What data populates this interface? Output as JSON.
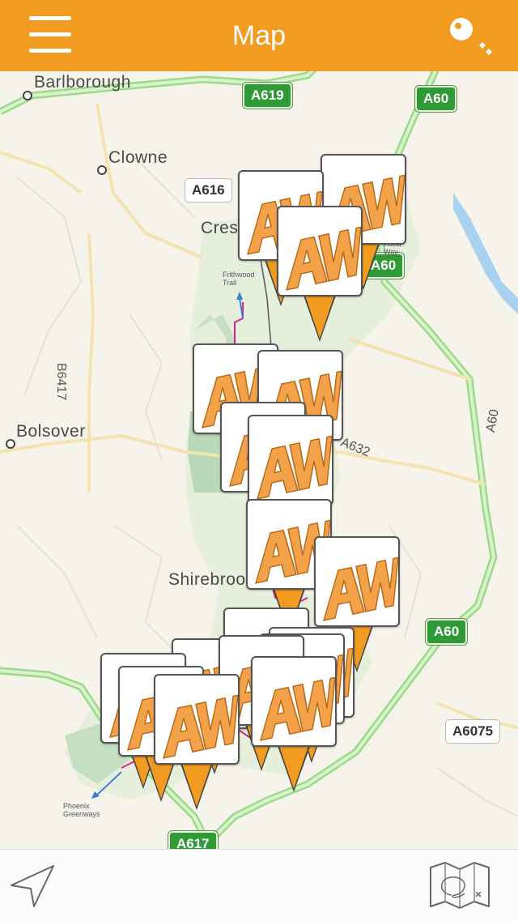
{
  "header": {
    "title": "Map",
    "menu_icon": "hamburger-menu-icon",
    "key_icon": "key-icon",
    "background": "#f19c20"
  },
  "map": {
    "places": {
      "barlborough": "Barlborough",
      "clowne": "Clowne",
      "creswell": "Cres",
      "bolsover": "Bolsover",
      "shirebrook": "Shirebrook"
    },
    "roads": {
      "a619": "A619",
      "a60_top": "A60",
      "a616": "A616",
      "a60_mid": "A60",
      "b6417": "B6417",
      "a632": "A632",
      "a60_right": "A60",
      "a60_lower": "A60",
      "a6075": "A6075",
      "a617": "A617"
    },
    "trails": {
      "frithwood": "Frithwood Trail",
      "phoenix": "Phoenix Greenways",
      "hood_way": "Robin Hood Way"
    },
    "pin_logo_text": "AW",
    "pin_color": "#f19c20"
  },
  "bottom_bar": {
    "locate_icon": "location-arrow-icon",
    "map_icon": "map-icon"
  }
}
